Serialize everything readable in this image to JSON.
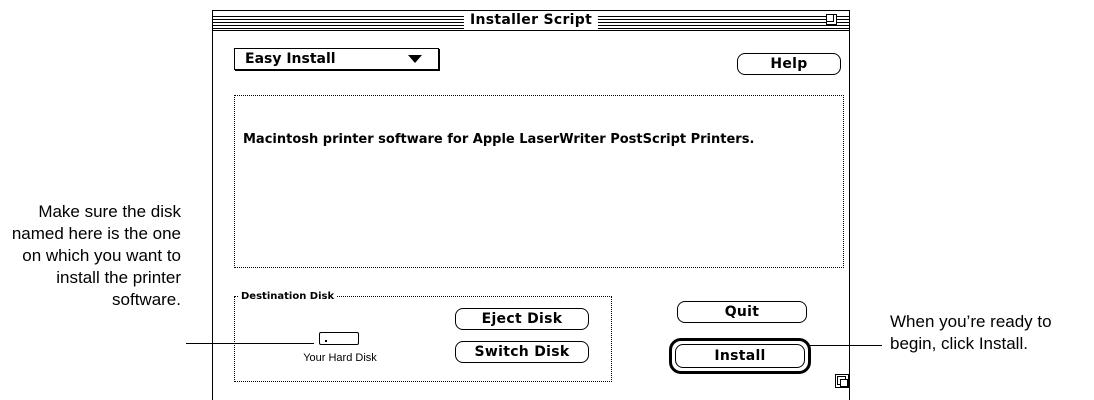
{
  "window": {
    "title": "Installer Script"
  },
  "popup": {
    "selected": "Easy Install"
  },
  "buttons": {
    "help": "Help",
    "eject": "Eject Disk",
    "switch": "Switch Disk",
    "quit": "Quit",
    "install": "Install"
  },
  "description": "Macintosh printer software for Apple LaserWriter PostScript Printers.",
  "destination": {
    "legend": "Destination Disk",
    "disk_name": "Your Hard Disk"
  },
  "callouts": {
    "left": "Make sure the disk named here is the one on which you want to install the printer software.",
    "right": "When you’re ready to begin, click Install."
  },
  "icons": [
    "zoom-box-icon",
    "popup-arrow-icon",
    "hard-disk-icon",
    "grow-box-icon"
  ]
}
